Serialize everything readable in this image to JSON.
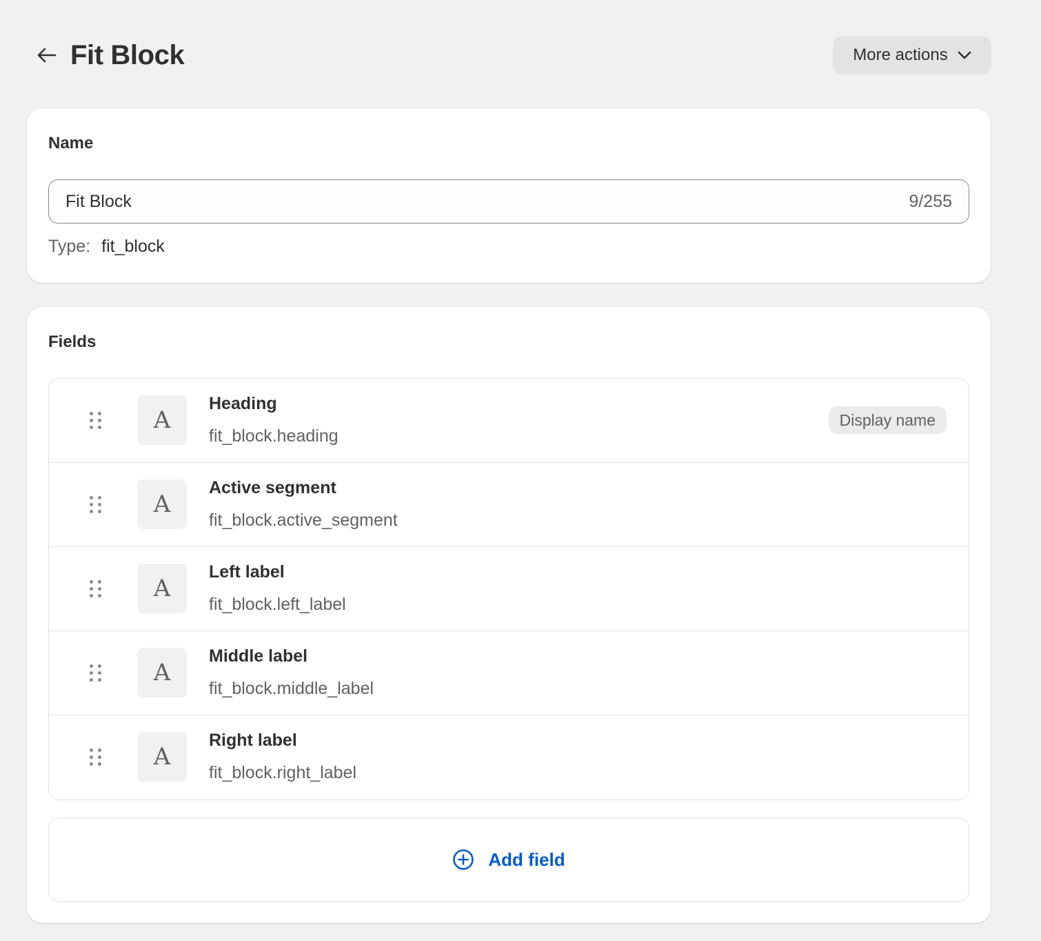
{
  "header": {
    "title": "Fit Block",
    "more_actions_label": "More actions"
  },
  "name_card": {
    "heading": "Name",
    "input_value": "Fit Block",
    "char_counter": "9/255",
    "type_label": "Type:",
    "type_value": "fit_block"
  },
  "fields_card": {
    "heading": "Fields",
    "items": [
      {
        "name": "Heading",
        "key": "fit_block.heading",
        "icon": "text-type-icon",
        "badge": "Display name"
      },
      {
        "name": "Active segment",
        "key": "fit_block.active_segment",
        "icon": "text-type-icon"
      },
      {
        "name": "Left label",
        "key": "fit_block.left_label",
        "icon": "text-type-icon"
      },
      {
        "name": "Middle label",
        "key": "fit_block.middle_label",
        "icon": "text-type-icon"
      },
      {
        "name": "Right label",
        "key": "fit_block.right_label",
        "icon": "text-type-icon"
      }
    ],
    "type_icon_glyph": "A",
    "add_field_label": "Add field"
  },
  "colors": {
    "background": "#f1f1f1",
    "card": "#ffffff",
    "link_blue": "#005bd3",
    "text_primary": "#303030",
    "text_secondary": "#616161"
  }
}
